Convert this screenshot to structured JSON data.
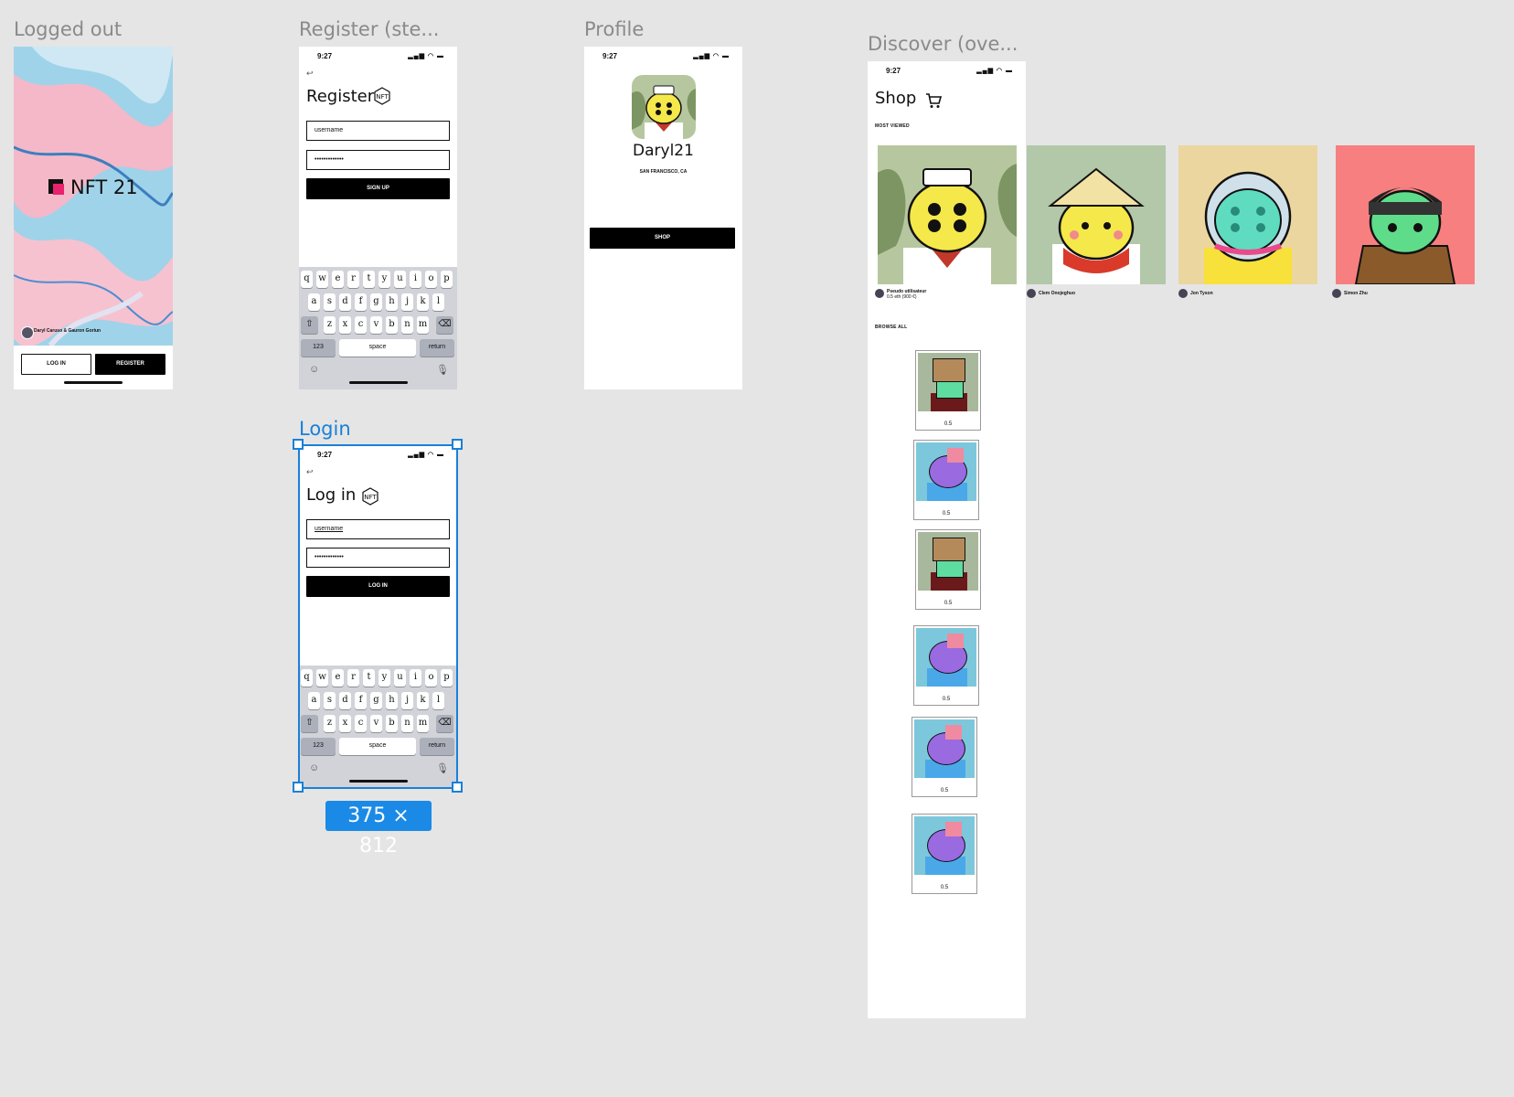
{
  "frames": {
    "logged_out": {
      "label": "Logged out",
      "logo_text": "NFT 21",
      "credit": "Daryl Caruso & Gauron Goriun",
      "login_label": "LOG IN",
      "register_label": "REGISTER"
    },
    "register": {
      "label": "Register (ste...",
      "time": "9:27",
      "back": "↩",
      "title": "Register",
      "username_value": "username",
      "password_value": "•••••••••••••",
      "submit_label": "SIGN UP"
    },
    "profile": {
      "label": "Profile",
      "time": "9:27",
      "name": "Daryl21",
      "location": "SAN FRANCISCO, CA",
      "shop_label": "SHOP"
    },
    "login": {
      "label": "Login",
      "time": "9:27",
      "back": "↩",
      "title": "Log in",
      "username_value": "username",
      "password_value": "•••••••••••••",
      "submit_label": "LOG IN",
      "dimensions": "375 × 812"
    },
    "discover": {
      "label": "Discover (ove...",
      "time": "9:27",
      "title": "Shop",
      "most_viewed": "MOST VIEWED",
      "browse_all": "BROWSE ALL",
      "featured": [
        {
          "author": "Pseudo utilisateur",
          "price": "0.5 eth (900 €)"
        },
        {
          "author": "Clem Onojeghuo",
          "price": ""
        },
        {
          "author": "Jon Tyson",
          "price": ""
        },
        {
          "author": "Simon Zhu",
          "price": ""
        }
      ],
      "browse": [
        {
          "price": "0.5"
        },
        {
          "price": "0.5"
        },
        {
          "price": "0.5"
        },
        {
          "price": "0.5"
        },
        {
          "price": "0.5"
        },
        {
          "price": "0.5"
        }
      ]
    }
  },
  "keyboard": {
    "row1": [
      "q",
      "w",
      "e",
      "r",
      "t",
      "y",
      "u",
      "i",
      "o",
      "p"
    ],
    "row2": [
      "a",
      "s",
      "d",
      "f",
      "g",
      "h",
      "j",
      "k",
      "l"
    ],
    "row3": [
      "z",
      "x",
      "c",
      "v",
      "b",
      "n",
      "m"
    ],
    "num_key": "123",
    "space_key": "space",
    "return_key": "return"
  },
  "colors": {
    "selection": "#1a80d8",
    "canvas": "#e5e5e5",
    "brand_pink": "#e8226c"
  }
}
